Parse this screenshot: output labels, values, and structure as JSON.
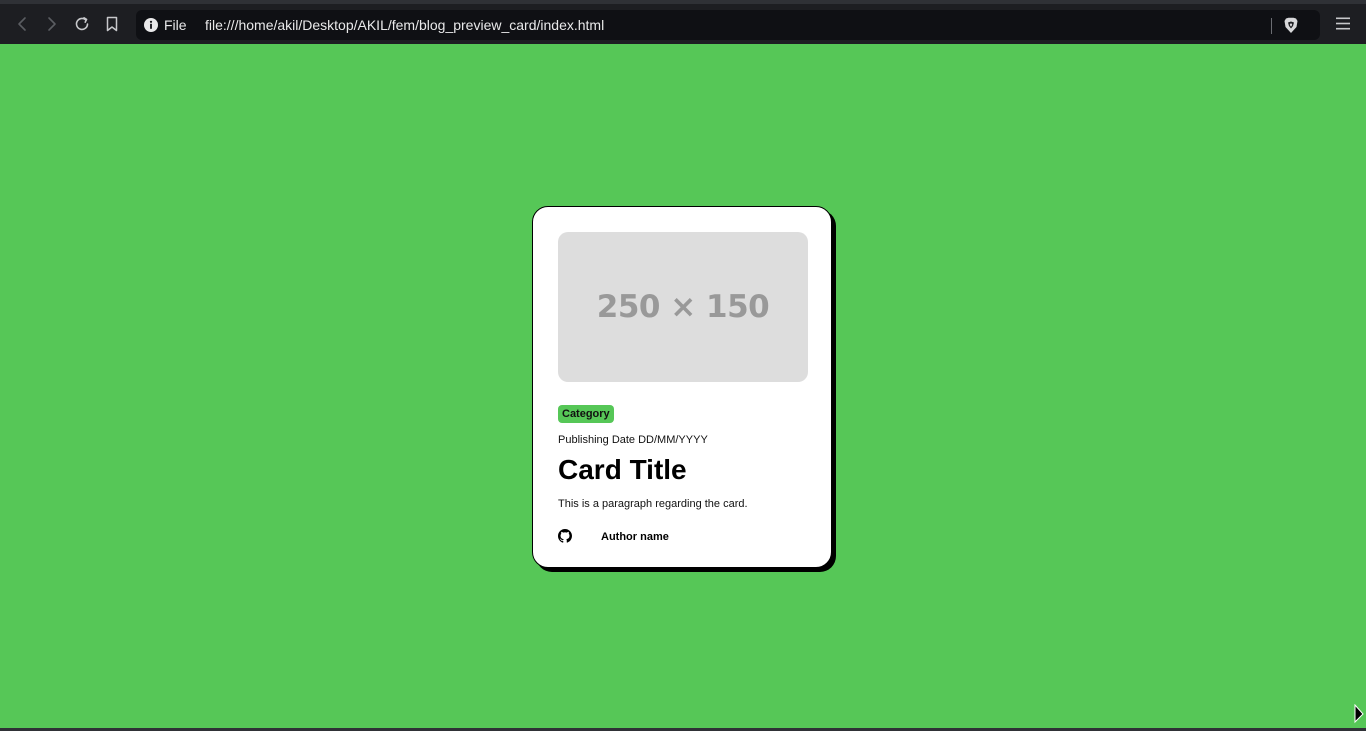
{
  "browser": {
    "scheme_label": "File",
    "url": "file:///home/akil/Desktop/AKIL/fem/blog_preview_card/index.html",
    "icons": {
      "back": "chevron-left-icon",
      "forward": "chevron-right-icon",
      "reload": "reload-icon",
      "bookmark": "bookmark-icon",
      "info": "info-icon",
      "brave": "brave-shield-icon",
      "menu": "hamburger-menu-icon"
    }
  },
  "page": {
    "background_color": "#56c757"
  },
  "card": {
    "image_placeholder": "250 × 150",
    "category": "Category",
    "category_color": "#56c757",
    "publishing_date": "Publishing Date DD/MM/YYYY",
    "title": "Card Title",
    "description": "This is a paragraph regarding the card.",
    "author_icon": "github-icon",
    "author_name": "Author name"
  }
}
